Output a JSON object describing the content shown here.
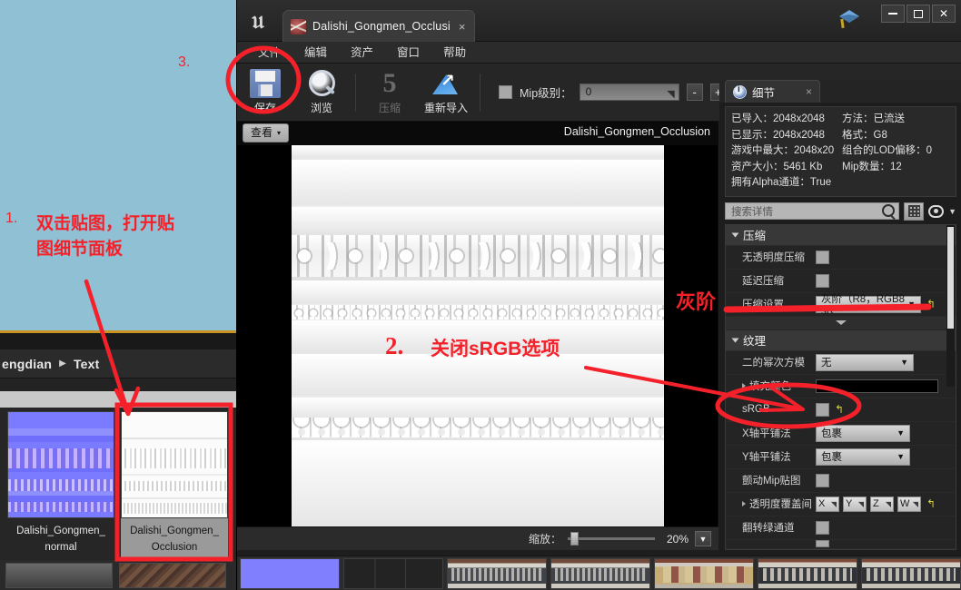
{
  "window": {
    "app_logo": "unreal-engine-logo",
    "tab_title": "Dalishi_Gongmen_Occlusi",
    "tab_close": "×",
    "minimize": "minimize-icon",
    "maximize": "maximize-icon",
    "close": "close-icon"
  },
  "menubar": {
    "items": [
      {
        "label": "文件",
        "name": "menu-file"
      },
      {
        "label": "编辑",
        "name": "menu-edit"
      },
      {
        "label": "资产",
        "name": "menu-asset"
      },
      {
        "label": "窗口",
        "name": "menu-window"
      },
      {
        "label": "帮助",
        "name": "menu-help"
      }
    ]
  },
  "toolbar": {
    "save_label": "保存",
    "browse_label": "浏览",
    "compress_label": "压缩",
    "reimport_label": "重新导入",
    "mip_label": "Mip级别：",
    "mip_value": "0",
    "step_minus": "-",
    "step_plus": "+"
  },
  "viewport": {
    "view_button": "查看",
    "view_caret": "▾",
    "title": "Dalishi_Gongmen_Occlusion",
    "zoom_label": "缩放：",
    "zoom_value": "20%",
    "zoom_caret": "▼"
  },
  "details": {
    "tab_label": "细节",
    "tab_close": "×",
    "info": [
      {
        "left": "已导入：2048x2048",
        "right": "方法：已流送"
      },
      {
        "left": "已显示：2048x2048",
        "right": "格式：G8"
      },
      {
        "left": "游戏中最大：2048x20",
        "right": "组合的LOD偏移：0"
      },
      {
        "left": "资产大小：5461 Kb",
        "right": "Mip数量：12"
      },
      {
        "left": "拥有Alpha通道：True",
        "right": ""
      }
    ],
    "search_placeholder": "搜索详情",
    "categories": {
      "compression": "压缩",
      "texture": "纹理"
    },
    "rows": {
      "alpha_compression": "无透明度压缩",
      "defer_compression": "延迟压缩",
      "compression_settings": "压缩设置",
      "compression_value": "灰阶（R8，RGB8 sR",
      "power_of_two": "二的幂次方模",
      "power_of_two_value": "无",
      "padding_color": "填充颜色",
      "srgb": "sRGB",
      "x_tiling": "X轴平铺法",
      "x_tiling_value": "包裹",
      "y_tiling": "Y轴平铺法",
      "y_tiling_value": "包裹",
      "dither_mip": "颤动Mip贴图",
      "alpha_coverage": "透明度覆盖间",
      "alpha_axes": [
        "X",
        "Y",
        "Z",
        "W"
      ],
      "flip_green": "翻转绿通道"
    },
    "reset_icon": "reset-arrow-icon"
  },
  "background_app": {
    "breadcrumb": "engdian",
    "breadcrumb_sep": "▶",
    "breadcrumb_last": "Text",
    "assets": [
      {
        "label_line1": "Dalishi_Gongmen_",
        "label_line2": "normal"
      },
      {
        "label_line1": "Dalishi_Gongmen_",
        "label_line2": "Occlusion"
      }
    ]
  },
  "annotations": {
    "step1_num": "1.",
    "step1_text_line1": "双击贴图，打开贴",
    "step1_text_line2": "图细节面板",
    "step2_num": "2.",
    "step2_text": "关闭sRGB选项",
    "step3_num": "3.",
    "grayscale_note": "灰阶",
    "color": "#f5212a"
  }
}
